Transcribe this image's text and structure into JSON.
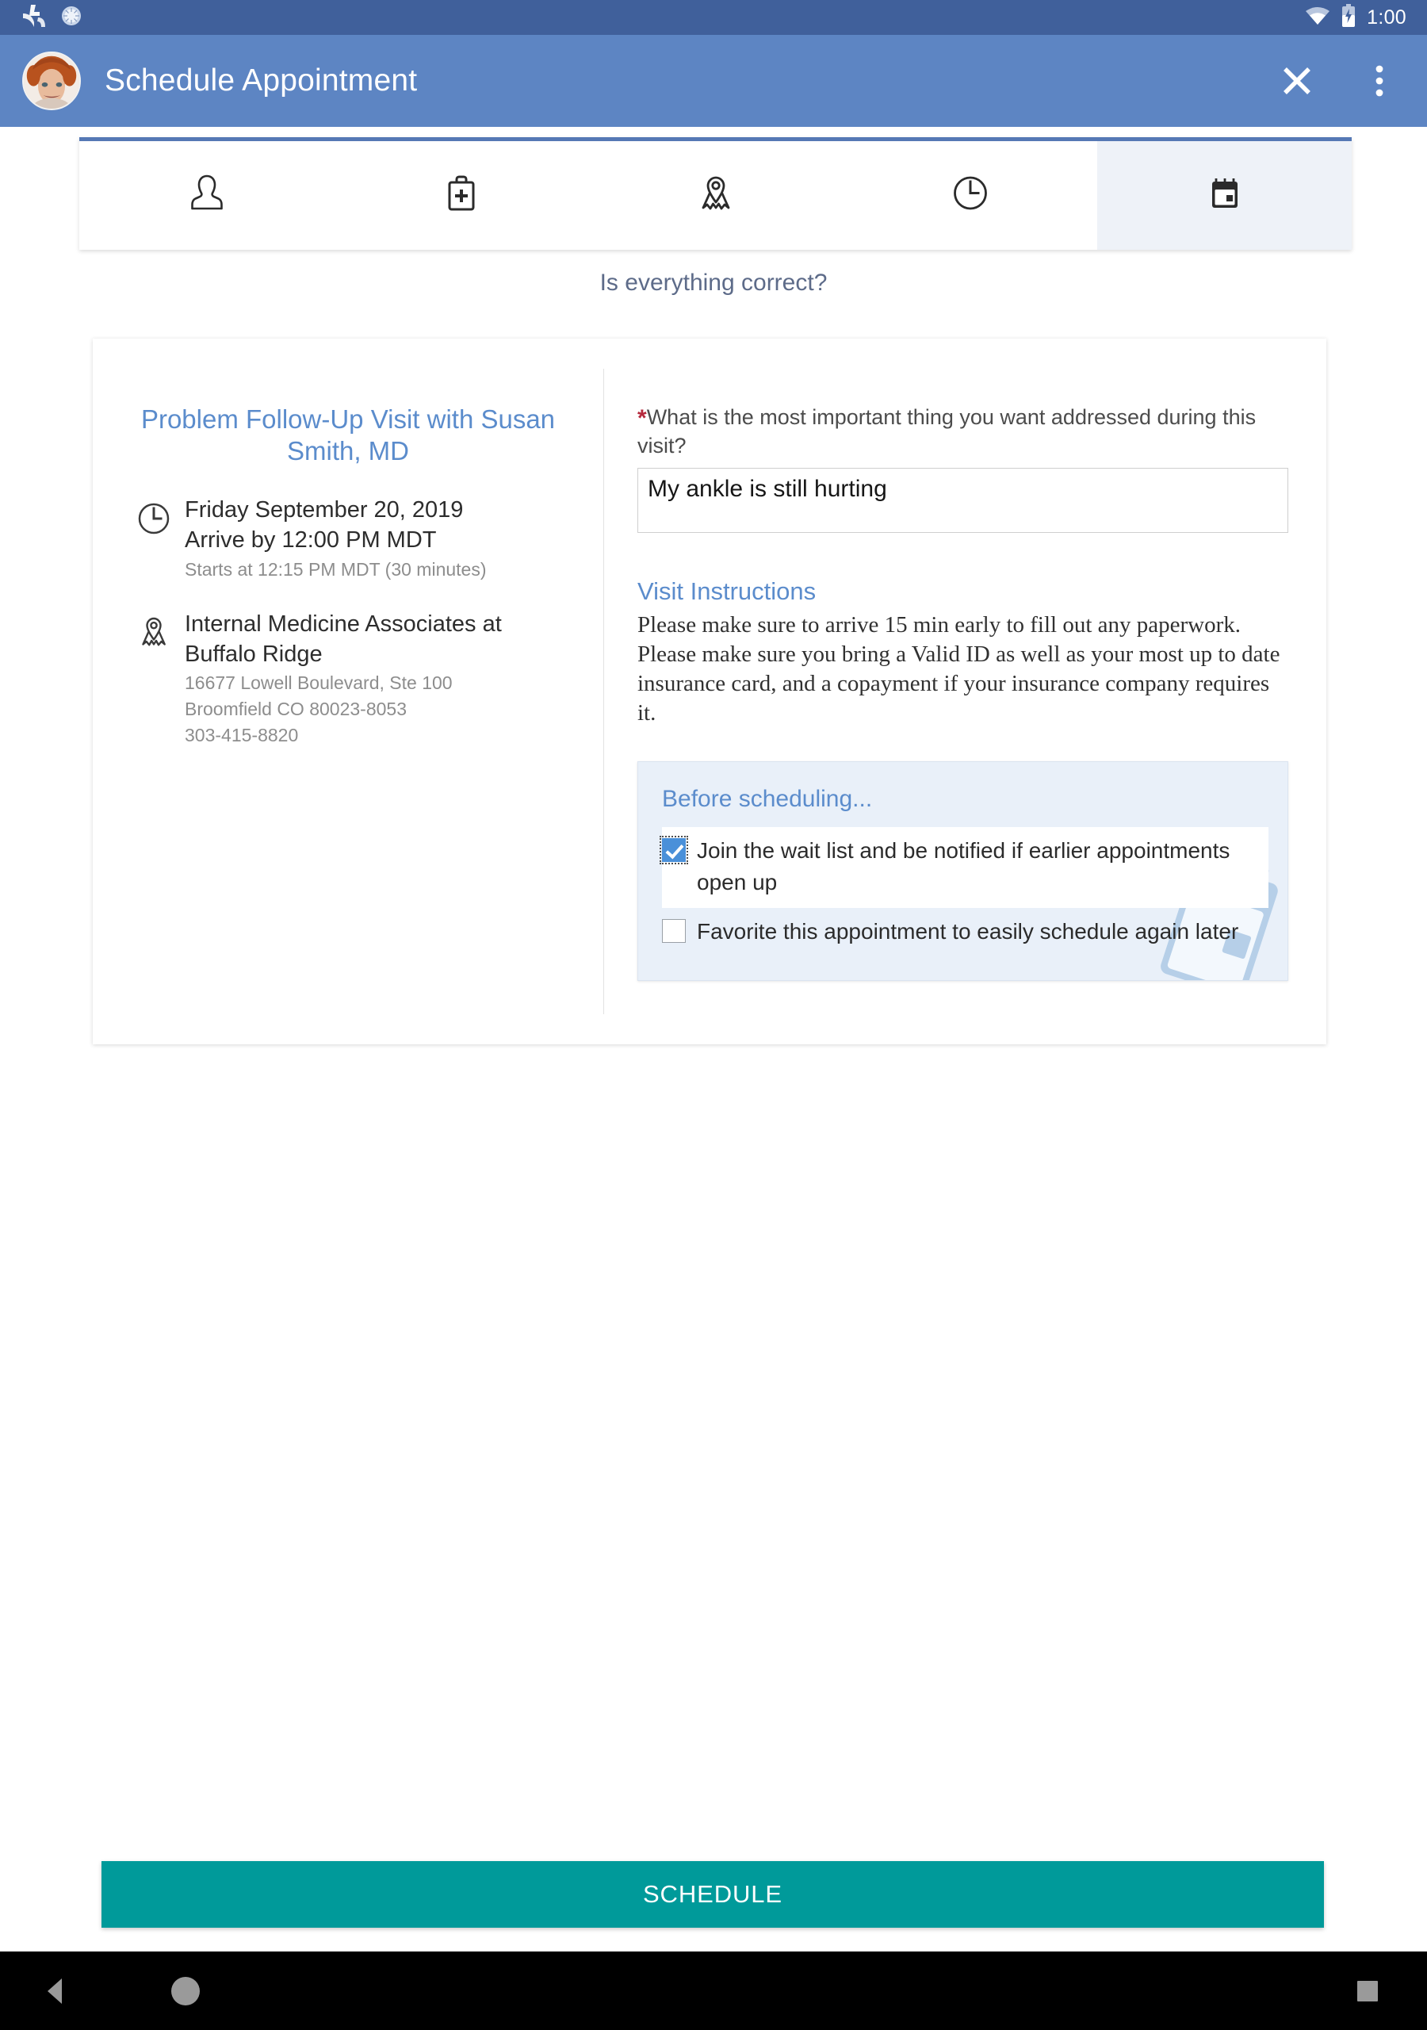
{
  "status_bar": {
    "icons": [
      "mychart-logo-icon",
      "sunburst-icon"
    ],
    "wifi_icon": "wifi-icon",
    "battery_icon": "battery-charging-icon",
    "time": "1:00"
  },
  "app_bar": {
    "avatar": "user-avatar",
    "title": "Schedule Appointment",
    "close_label": "close-icon",
    "overflow_label": "more-options-icon"
  },
  "tabs": [
    {
      "name": "patient",
      "icon": "person-icon",
      "active": false
    },
    {
      "name": "visit-type",
      "icon": "medical-bag-icon",
      "active": false
    },
    {
      "name": "location",
      "icon": "map-pin-icon",
      "active": false
    },
    {
      "name": "time",
      "icon": "clock-icon",
      "active": false
    },
    {
      "name": "review",
      "icon": "calendar-icon",
      "active": true
    }
  ],
  "subtitle": "Is everything correct?",
  "appointment": {
    "title": "Problem Follow-Up Visit with Susan Smith, MD",
    "when": {
      "icon": "clock-icon",
      "date": "Friday September 20, 2019",
      "arrive": "Arrive by 12:00 PM MDT",
      "starts": "Starts at 12:15 PM MDT (30 minutes)"
    },
    "where": {
      "icon": "map-pin-icon",
      "department": "Internal Medicine Associates at Buffalo Ridge",
      "street": "16677 Lowell Boulevard, Ste 100",
      "city_state_zip": "Broomfield CO 80023-8053",
      "phone": "303-415-8820"
    }
  },
  "question": {
    "required_marker": "*",
    "label": "What is the most important thing you want addressed during this visit?",
    "value": "My ankle is still hurting",
    "placeholder": ""
  },
  "visit_instructions": {
    "heading": "Visit Instructions",
    "body": "Please make sure to arrive 15 min early to fill out any paperwork. Please make sure you bring a Valid ID as well as your most up to date insurance card, and a copayment if your insurance company requires it."
  },
  "before_scheduling": {
    "heading": "Before scheduling...",
    "options": [
      {
        "label": "Join the wait list and be notified if earlier appointments open up",
        "checked": true,
        "focused": true
      },
      {
        "label": "Favorite this appointment to easily schedule again later",
        "checked": false,
        "focused": false
      }
    ],
    "watermark_icon": "tilted-calendar-icon"
  },
  "primary_action": {
    "label": "SCHEDULE",
    "color": "#009a9a"
  },
  "nav_bar": {
    "back": "back-triangle-icon",
    "home": "home-circle-icon",
    "recents": "recents-square-icon"
  },
  "colors": {
    "status_bar": "#40609b",
    "app_bar": "#5d85c3",
    "accent_blue": "#5b8ccc",
    "tab_active": "#eef2f8",
    "panel_bg": "#e9f0f9",
    "teal": "#009a9a",
    "required_red": "#b5293c"
  }
}
